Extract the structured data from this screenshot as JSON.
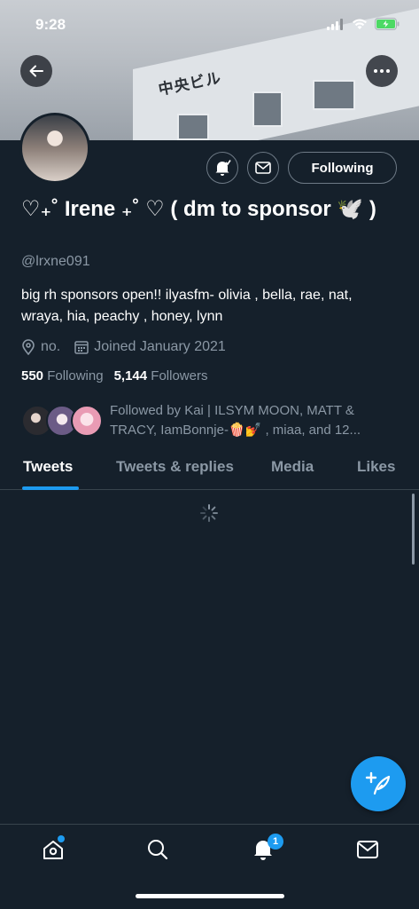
{
  "status_bar": {
    "time": "9:28"
  },
  "header": {
    "banner_sign_text": "中央ビル"
  },
  "profile": {
    "name": "♡₊˚ Irene ₊˚ ♡ ( dm to sponsor 🕊️ )",
    "handle": "@lrxne091",
    "bio": "big rh sponsors open!! ilyasfm- olivia , bella, rae, nat, wraya, hia, peachy , honey, lynn",
    "location": "no.",
    "joined": "Joined January 2021",
    "following_count": "550",
    "following_label": "Following",
    "followers_count": "5,144",
    "followers_label": "Followers",
    "follow_button_label": "Following",
    "followed_by": "Followed by Kai | ILSYM MOON, MATT & TRACY, IamBonnje-🍿💅 , miaa, and 12..."
  },
  "tabs": [
    {
      "label": "Tweets",
      "active": true
    },
    {
      "label": "Tweets & replies",
      "active": false
    },
    {
      "label": "Media",
      "active": false
    },
    {
      "label": "Likes",
      "active": false
    }
  ],
  "bottom_nav": {
    "items": [
      "home-icon",
      "search-icon",
      "notifications-icon",
      "messages-icon"
    ],
    "notifications_badge": "1"
  },
  "colors": {
    "background": "#15202b",
    "accent": "#1d9bf0",
    "secondary_text": "#8b98a5",
    "border": "#38444d"
  }
}
